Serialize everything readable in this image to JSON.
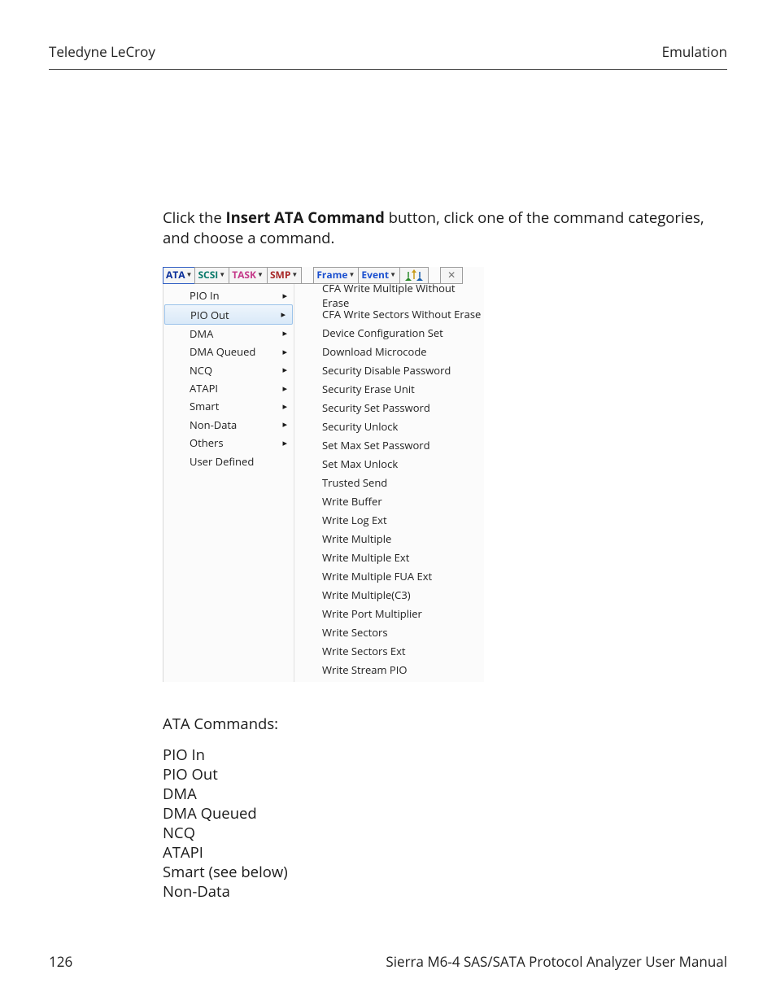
{
  "header": {
    "left": "Teledyne LeCroy",
    "right": "Emulation"
  },
  "intro": {
    "pre": "Click the ",
    "bold": "Insert ATA Command",
    "post": " button, click one of the command categories, and choose a command."
  },
  "toolbar": {
    "ata": "ATA",
    "scsi": "SCSI",
    "task": "TASK",
    "smp": "SMP",
    "frame": "Frame",
    "event": "Event",
    "close": "✕"
  },
  "left_menu": [
    {
      "label": "PIO In",
      "sub": true,
      "highlight": false
    },
    {
      "label": "PIO Out",
      "sub": true,
      "highlight": true
    },
    {
      "label": "DMA",
      "sub": true,
      "highlight": false
    },
    {
      "label": "DMA Queued",
      "sub": true,
      "highlight": false
    },
    {
      "label": "NCQ",
      "sub": true,
      "highlight": false
    },
    {
      "label": "ATAPI",
      "sub": true,
      "highlight": false
    },
    {
      "label": "Smart",
      "sub": true,
      "highlight": false
    },
    {
      "label": "Non-Data",
      "sub": true,
      "highlight": false
    },
    {
      "label": "Others",
      "sub": true,
      "highlight": false
    },
    {
      "label": "User Defined",
      "sub": false,
      "highlight": false
    }
  ],
  "right_menu": [
    "CFA Write Multiple Without Erase",
    "CFA Write Sectors Without Erase",
    "Device Configuration Set",
    "Download Microcode",
    "Security Disable Password",
    "Security Erase Unit",
    "Security Set Password",
    "Security Unlock",
    "Set Max Set Password",
    "Set Max Unlock",
    "Trusted Send",
    "Write Buffer",
    "Write Log Ext",
    "Write Multiple",
    "Write Multiple Ext",
    "Write Multiple FUA Ext",
    "Write Multiple(C3)",
    "Write Port Multiplier",
    "Write Sectors",
    "Write Sectors Ext",
    "Write Stream PIO"
  ],
  "after": {
    "heading": "ATA Commands:",
    "items": [
      "PIO In",
      "PIO Out",
      "DMA",
      "DMA Queued",
      "NCQ",
      "ATAPI",
      "Smart (see below)",
      "Non-Data"
    ]
  },
  "footer": {
    "left": "126",
    "right": "Sierra M6-4 SAS/SATA Protocol Analyzer User Manual"
  }
}
